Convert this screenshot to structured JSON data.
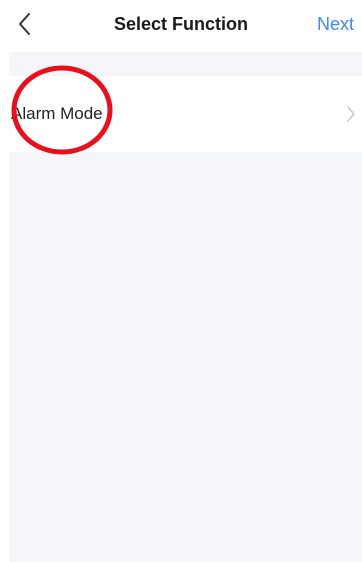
{
  "nav": {
    "back_icon": "chevron-left-icon",
    "title": "Select Function",
    "next_label": "Next"
  },
  "list": {
    "items": [
      {
        "label": "Alarm Mode",
        "icon": "chevron-right-icon"
      }
    ]
  },
  "annotation": {
    "shape": "red-circle",
    "color": "#e8101c"
  },
  "colors": {
    "accent": "#3d8bf0",
    "background": "#f5f6f9"
  }
}
